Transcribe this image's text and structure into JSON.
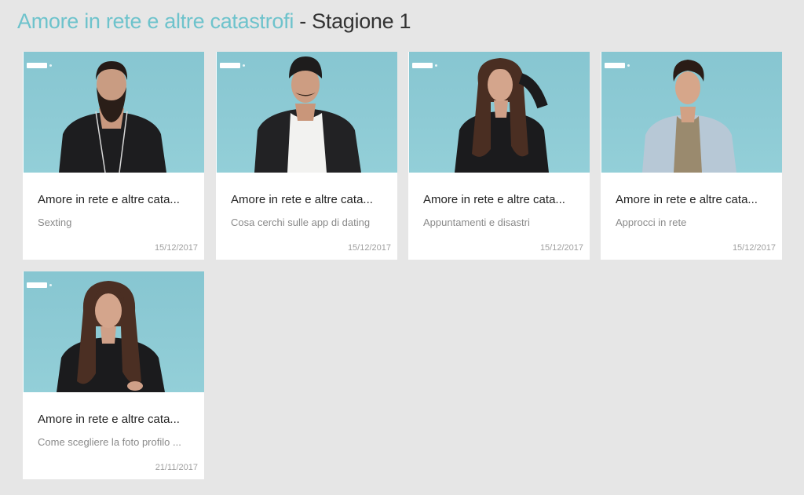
{
  "header": {
    "series_title": "Amore in rete e altre catastrofi",
    "season_label": " - Stagione 1"
  },
  "colors": {
    "accent": "#6ec3cc",
    "thumb_bg": "#8ecbd5",
    "page_bg": "#e6e6e6"
  },
  "episodes": [
    {
      "title": "Amore in rete e altre cata...",
      "subtitle": "Sexting",
      "date": "15/12/2017",
      "person": "bearded-man"
    },
    {
      "title": "Amore in rete e altre cata...",
      "subtitle": "Cosa cerchi sulle app di dating",
      "date": "15/12/2017",
      "person": "man-with-beanie"
    },
    {
      "title": "Amore in rete e altre cata...",
      "subtitle": "Appuntamenti e disastri",
      "date": "15/12/2017",
      "person": "woman-long-hair"
    },
    {
      "title": "Amore in rete e altre cata...",
      "subtitle": "Approcci in rete",
      "date": "15/12/2017",
      "person": "man-denim-jacket"
    },
    {
      "title": "Amore in rete e altre cata...",
      "subtitle": "Come scegliere la foto profilo ...",
      "date": "21/11/2017",
      "person": "woman-long-hair"
    }
  ]
}
